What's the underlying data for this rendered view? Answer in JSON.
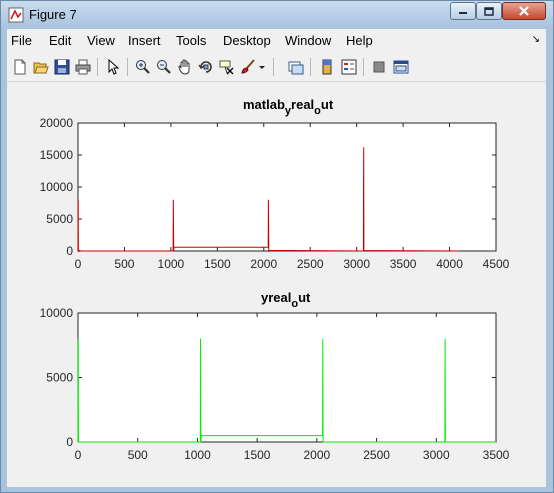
{
  "window": {
    "title": "Figure 7"
  },
  "menu": {
    "items": [
      "File",
      "Edit",
      "View",
      "Insert",
      "Tools",
      "Desktop",
      "Window",
      "Help"
    ]
  },
  "toolbar": {
    "icons": [
      "new-figure-icon",
      "open-file-icon",
      "save-icon",
      "print-icon",
      "edit-plot-arrow-icon",
      "zoom-in-icon",
      "zoom-out-icon",
      "pan-hand-icon",
      "rotate-3d-icon",
      "data-cursor-icon",
      "brush-icon",
      "brush-dropdown-icon",
      "link-plot-icon",
      "insert-colorbar-icon",
      "insert-legend-icon",
      "hide-plot-tools-icon",
      "show-plot-tools-icon"
    ]
  },
  "colors": {
    "series1": "#cc0000",
    "series2": "#00ee00"
  },
  "chart_data": [
    {
      "type": "line",
      "title_main": "matlab",
      "title_sub1": "y",
      "title_mid": "real",
      "title_sub2": "o",
      "title_end": "ut",
      "xlim": [
        0,
        4500
      ],
      "ylim": [
        0,
        20000
      ],
      "xticks": [
        0,
        500,
        1000,
        1500,
        2000,
        2500,
        3000,
        3500,
        4000,
        4500
      ],
      "yticks": [
        0,
        5000,
        10000,
        15000,
        20000
      ],
      "grid": false,
      "series": [
        {
          "x": [
            0,
            2,
            4,
            10,
            30,
            1024,
            1026,
            1030,
            1034,
            1040,
            2048,
            2050,
            2054,
            2058,
            3072,
            3074,
            3076,
            3078,
            3080,
            4096
          ],
          "y": [
            0,
            8000,
            0,
            120,
            0,
            0,
            8000,
            0,
            600,
            600,
            600,
            8000,
            0,
            100,
            0,
            8000,
            16200,
            0,
            80,
            0
          ]
        }
      ]
    },
    {
      "type": "line",
      "title_main": "yreal",
      "title_sub1": "o",
      "title_end": "ut",
      "xlim": [
        0,
        3500
      ],
      "ylim": [
        0,
        10000
      ],
      "xticks": [
        0,
        500,
        1000,
        1500,
        2000,
        2500,
        3000,
        3500
      ],
      "yticks": [
        0,
        5000,
        10000
      ],
      "grid": false,
      "series": [
        {
          "x": [
            0,
            2,
            4,
            10,
            1024,
            1026,
            1028,
            1032,
            1036,
            2048,
            2050,
            2052,
            3072,
            3074,
            3076,
            3500
          ],
          "y": [
            0,
            8000,
            0,
            0,
            0,
            8000,
            0,
            500,
            500,
            500,
            8000,
            0,
            0,
            8000,
            0,
            0
          ]
        }
      ]
    }
  ]
}
